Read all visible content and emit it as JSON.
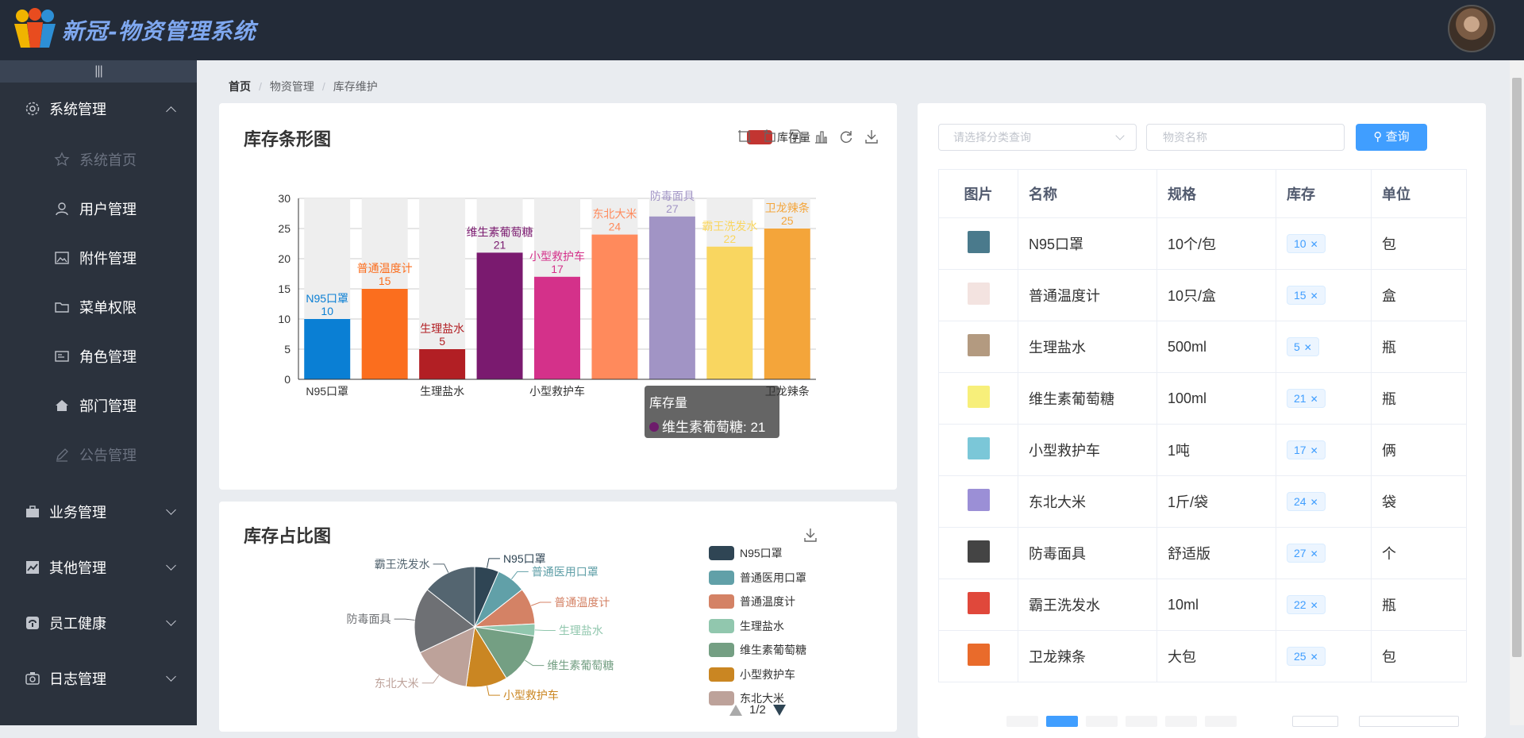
{
  "app": {
    "title": "新冠-物资管理系统"
  },
  "sidebar": {
    "toggle": "|||",
    "groups": [
      {
        "label": "系统管理",
        "icon": "gear-icon",
        "expanded": true
      },
      {
        "label": "业务管理",
        "icon": "briefcase-icon"
      },
      {
        "label": "其他管理",
        "icon": "chart-icon"
      },
      {
        "label": "员工健康",
        "icon": "health-icon"
      },
      {
        "label": "日志管理",
        "icon": "camera-icon"
      }
    ],
    "sub_items": [
      {
        "label": "系统首页",
        "icon": "star-icon",
        "disabled": true
      },
      {
        "label": "用户管理",
        "icon": "user-icon"
      },
      {
        "label": "附件管理",
        "icon": "picture-icon"
      },
      {
        "label": "菜单权限",
        "icon": "folder-icon"
      },
      {
        "label": "角色管理",
        "icon": "postcard-icon"
      },
      {
        "label": "部门管理",
        "icon": "house-icon"
      },
      {
        "label": "公告管理",
        "icon": "edit-icon",
        "disabled": true
      }
    ]
  },
  "breadcrumb": {
    "home": "首页",
    "level2": "物资管理",
    "level3": "库存维护",
    "sep": "/"
  },
  "bar_card": {
    "title": "库存条形图",
    "legend": "库存量"
  },
  "pie_card": {
    "title": "库存占比图",
    "pager": "1/2"
  },
  "tooltip": {
    "series": "库存量",
    "item": "维生素葡萄糖: 21"
  },
  "search": {
    "category_placeholder": "请选择分类查询",
    "name_placeholder": "物资名称",
    "query_label": "查询"
  },
  "table": {
    "headers": [
      "图片",
      "名称",
      "规格",
      "库存",
      "单位"
    ],
    "rows": [
      {
        "name": "N95口罩",
        "spec": "10个/包",
        "stock": "10",
        "unit": "包"
      },
      {
        "name": "普通温度计",
        "spec": "10只/盒",
        "stock": "15",
        "unit": "盒"
      },
      {
        "name": "生理盐水",
        "spec": "500ml",
        "stock": "5",
        "unit": "瓶"
      },
      {
        "name": "维生素葡萄糖",
        "spec": "100ml",
        "stock": "21",
        "unit": "瓶"
      },
      {
        "name": "小型救护车",
        "spec": "1吨",
        "stock": "17",
        "unit": "俩"
      },
      {
        "name": "东北大米",
        "spec": "1斤/袋",
        "stock": "24",
        "unit": "袋"
      },
      {
        "name": "防毒面具",
        "spec": "舒适版",
        "stock": "27",
        "unit": "个"
      },
      {
        "name": "霸王洗发水",
        "spec": "10ml",
        "stock": "22",
        "unit": "瓶"
      },
      {
        "name": "卫龙辣条",
        "spec": "大包",
        "stock": "25",
        "unit": "包"
      }
    ]
  },
  "colors": {
    "accent": "#409eff",
    "sidebar": "#2b323d",
    "topbar": "#232b38"
  },
  "chart_data": [
    {
      "type": "bar",
      "title": "库存条形图",
      "categories": [
        "N95口罩",
        "普通温度计",
        "生理盐水",
        "维生素葡萄糖",
        "小型救护车",
        "东北大米",
        "防毒面具",
        "霸王洗发水",
        "卫龙辣条"
      ],
      "series": [
        {
          "name": "库存量",
          "values": [
            10,
            15,
            5,
            21,
            17,
            24,
            27,
            22,
            25
          ]
        }
      ],
      "colors": [
        "#0a7fd4",
        "#fb6e1e",
        "#b21f24",
        "#7a1a6f",
        "#d4318a",
        "#ff8a5c",
        "#a194c5",
        "#f9d660",
        "#f4a53a"
      ],
      "ylim": [
        0,
        30
      ],
      "yticks": [
        0,
        5,
        10,
        15,
        20,
        25,
        30
      ],
      "xtick_labels": [
        "N95口罩",
        "生理盐水",
        "小型救护车",
        "卫龙辣条"
      ],
      "legend": "top-center"
    },
    {
      "type": "pie",
      "title": "库存占比图",
      "labels": [
        "N95口罩",
        "普通医用口罩",
        "普通温度计",
        "生理盐水",
        "维生素葡萄糖",
        "小型救护车",
        "东北大米",
        "防毒面具",
        "霸王洗发水"
      ],
      "values": [
        10,
        12,
        15,
        5,
        21,
        17,
        24,
        27,
        22
      ],
      "colors": [
        "#2f4554",
        "#61a0a8",
        "#d48265",
        "#91c7ae",
        "#749f83",
        "#ca8622",
        "#bda29a",
        "#6e7074",
        "#546570"
      ],
      "legend_visible": [
        "N95口罩",
        "普通医用口罩",
        "普通温度计",
        "生理盐水",
        "维生素葡萄糖",
        "小型救护车",
        "东北大米"
      ]
    }
  ]
}
